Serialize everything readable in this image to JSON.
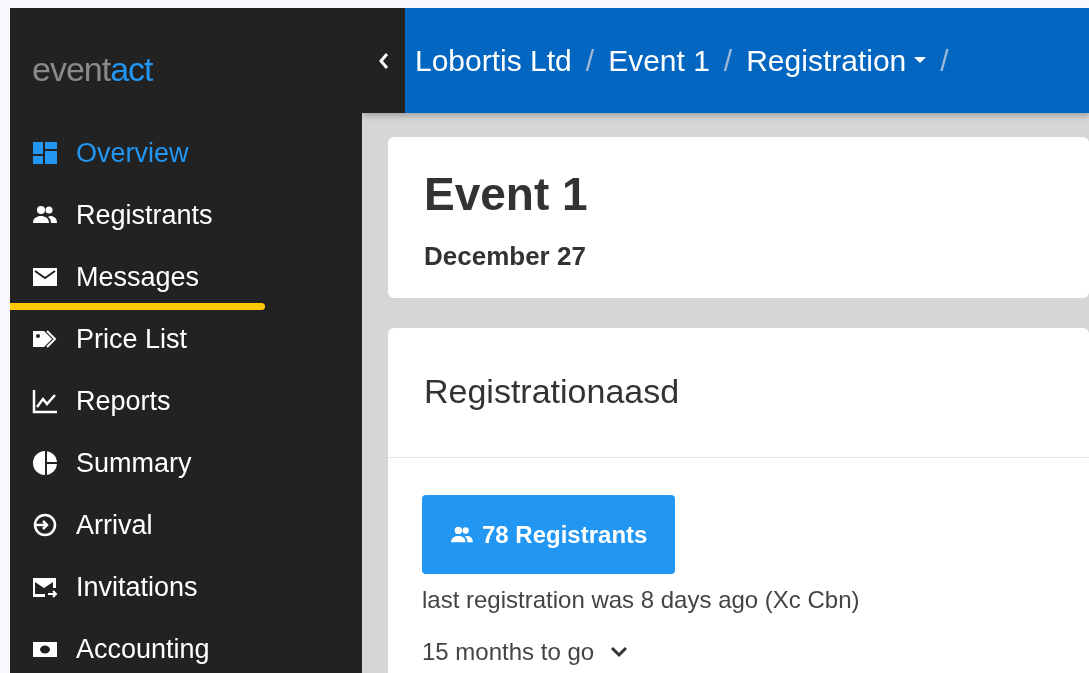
{
  "logo": {
    "part_1": "event",
    "part_2": "act"
  },
  "sidebar": {
    "items": [
      {
        "label": "Overview",
        "selected": true,
        "underlined": false
      },
      {
        "label": "Registrants",
        "selected": false,
        "underlined": false
      },
      {
        "label": "Messages",
        "selected": false,
        "underlined": true
      },
      {
        "label": "Price List",
        "selected": false,
        "underlined": false
      },
      {
        "label": "Reports",
        "selected": false,
        "underlined": false
      },
      {
        "label": "Summary",
        "selected": false,
        "underlined": false
      },
      {
        "label": "Arrival",
        "selected": false,
        "underlined": false
      },
      {
        "label": "Invitations",
        "selected": false,
        "underlined": false
      },
      {
        "label": "Accounting",
        "selected": false,
        "underlined": false
      }
    ]
  },
  "breadcrumb": [
    {
      "label": "Lobortis Ltd",
      "dropdown": false,
      "separator": "/"
    },
    {
      "label": "Event 1",
      "dropdown": false,
      "separator": "/"
    },
    {
      "label": "Registration",
      "dropdown": true,
      "separator": "/"
    }
  ],
  "event": {
    "title": "Event 1",
    "date": "December 27"
  },
  "registration": {
    "title": "Registrationaasd",
    "button": "78 Registrants",
    "last": "last registration was 8 days ago (Xc Cbn)",
    "countdown": "15 months to go"
  }
}
